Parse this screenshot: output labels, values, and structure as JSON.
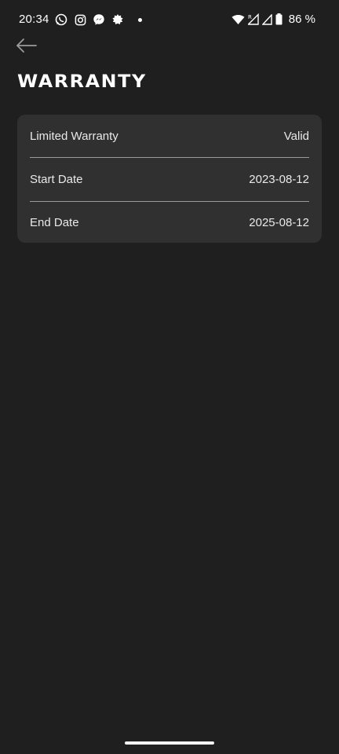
{
  "status_bar": {
    "time": "20:34",
    "battery": "86 %",
    "left_icons": [
      "whatsapp-icon",
      "instagram-icon",
      "messenger-icon",
      "notification-app-icon"
    ],
    "right_icons": [
      "wifi-icon",
      "signal-roaming-icon",
      "signal-icon",
      "battery-icon"
    ]
  },
  "header": {
    "back_icon": "arrow-left-icon",
    "title": "WARRANTY"
  },
  "warranty": {
    "rows": [
      {
        "label": "Limited Warranty",
        "value": "Valid"
      },
      {
        "label": "Start Date",
        "value": "2023-08-12"
      },
      {
        "label": "End Date",
        "value": "2025-08-12"
      }
    ]
  },
  "colors": {
    "background": "#1f1f1f",
    "card": "#303030",
    "text": "#e9e9e9",
    "divider": "#9a9a9a"
  }
}
